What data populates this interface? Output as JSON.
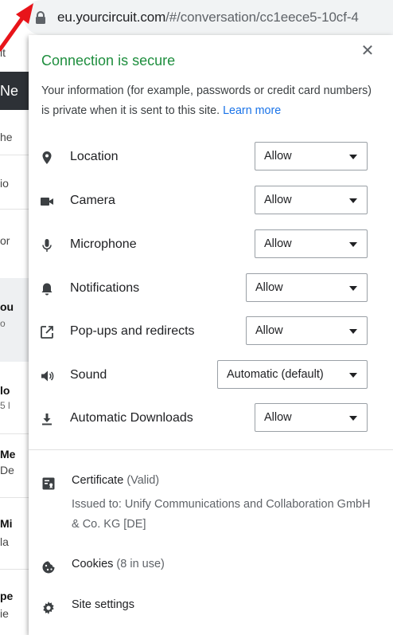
{
  "url_bar": {
    "host": "eu.yourcircuit.com",
    "path": "/#/conversation/cc1eece5-10cf-4"
  },
  "background_fragments": [
    "it",
    "Ne",
    "he",
    "io",
    "or",
    "ou",
    "o",
    "lo",
    "5 l",
    "Me",
    "De",
    "Mi",
    "la",
    "pe",
    "ie"
  ],
  "popup": {
    "title": "Connection is secure",
    "description": "Your information (for example, passwords or credit card numbers) is private when it is sent to this site.",
    "learn_more": "Learn more",
    "permissions": [
      {
        "icon": "location-pin-icon",
        "label": "Location",
        "value": "Allow"
      },
      {
        "icon": "camera-icon",
        "label": "Camera",
        "value": "Allow"
      },
      {
        "icon": "microphone-icon",
        "label": "Microphone",
        "value": "Allow"
      },
      {
        "icon": "bell-icon",
        "label": "Notifications",
        "value": "Allow"
      },
      {
        "icon": "popup-icon",
        "label": "Pop-ups and redirects",
        "value": "Allow"
      },
      {
        "icon": "speaker-icon",
        "label": "Sound",
        "value": "Automatic (default)"
      },
      {
        "icon": "download-icon",
        "label": "Automatic Downloads",
        "value": "Allow"
      }
    ],
    "certificate": {
      "label": "Certificate",
      "status": "(Valid)",
      "issued_to": "Issued to: Unify Communications and Collaboration GmbH & Co. KG [DE]"
    },
    "cookies": {
      "label": "Cookies",
      "count": "(8 in use)"
    },
    "site_settings": "Site settings"
  },
  "colors": {
    "secure_title": "#1e8e3e",
    "link": "#1a73e8",
    "arrow": "#e8141a"
  }
}
